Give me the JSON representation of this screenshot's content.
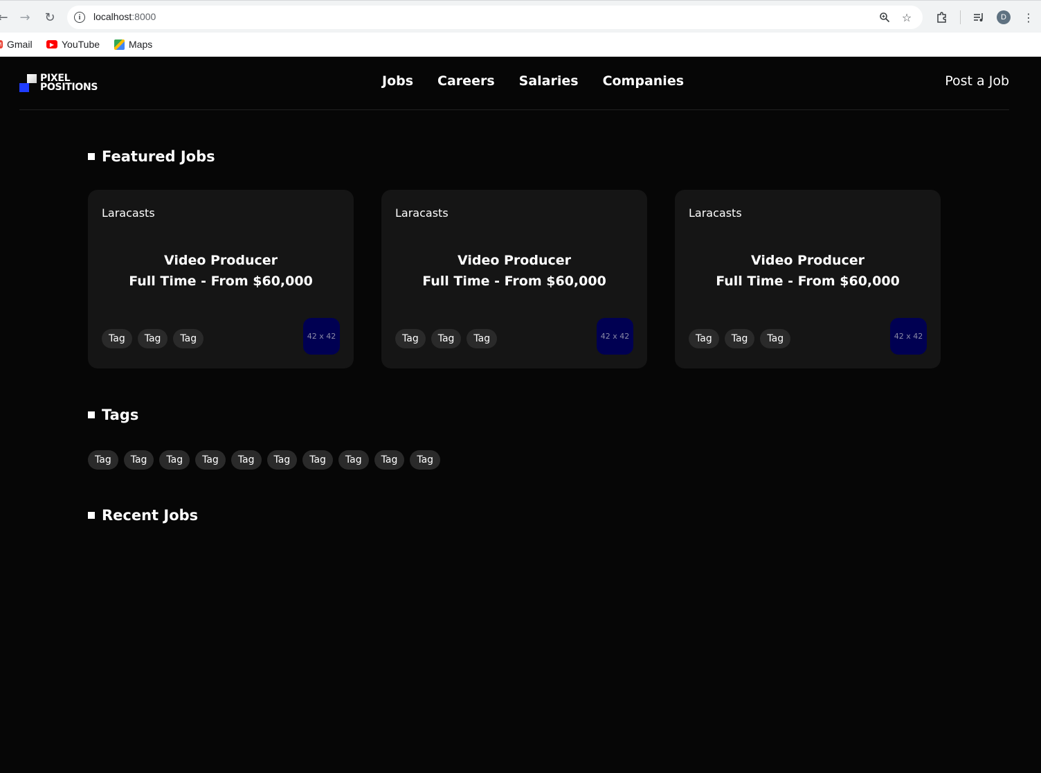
{
  "browser": {
    "url_host": "localhost",
    "url_port": ":8000",
    "avatar_letter": "D",
    "bookmarks": [
      {
        "label": "Gmail"
      },
      {
        "label": "YouTube"
      },
      {
        "label": "Maps"
      }
    ]
  },
  "site": {
    "logo_line1": "PIXEL",
    "logo_line2": "POSITIONS",
    "nav": [
      "Jobs",
      "Careers",
      "Salaries",
      "Companies"
    ],
    "post_job": "Post a Job"
  },
  "sections": {
    "featured": "Featured Jobs",
    "tags": "Tags",
    "recent": "Recent Jobs"
  },
  "featured_jobs": [
    {
      "company": "Laracasts",
      "title": "Video Producer",
      "subtitle": "Full Time - From $60,000",
      "tags": [
        "Tag",
        "Tag",
        "Tag"
      ],
      "logo_placeholder": "42 x 42"
    },
    {
      "company": "Laracasts",
      "title": "Video Producer",
      "subtitle": "Full Time - From $60,000",
      "tags": [
        "Tag",
        "Tag",
        "Tag"
      ],
      "logo_placeholder": "42 x 42"
    },
    {
      "company": "Laracasts",
      "title": "Video Producer",
      "subtitle": "Full Time - From $60,000",
      "tags": [
        "Tag",
        "Tag",
        "Tag"
      ],
      "logo_placeholder": "42 x 42"
    }
  ],
  "all_tags": [
    "Tag",
    "Tag",
    "Tag",
    "Tag",
    "Tag",
    "Tag",
    "Tag",
    "Tag",
    "Tag",
    "Tag"
  ],
  "colors": {
    "background": "#060606",
    "card": "#151515",
    "tag": "#2a2a2a",
    "logo_blue": "#1f3cff",
    "placeholder_bg": "#000052"
  }
}
